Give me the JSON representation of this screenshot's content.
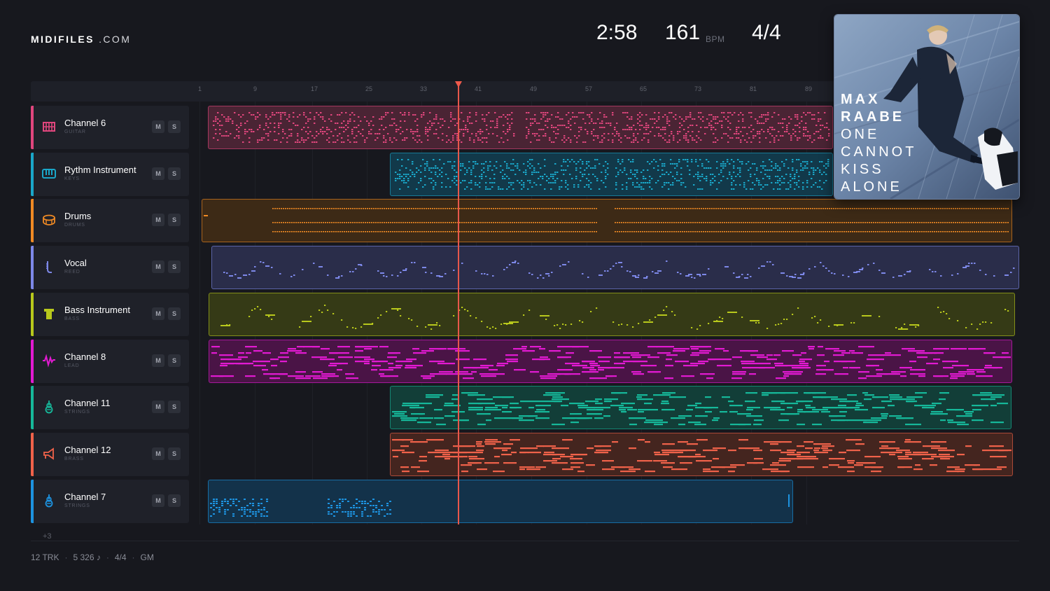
{
  "brand": {
    "name_bold": "MIDIFILES",
    "name_suffix": ".COM"
  },
  "transport": {
    "time": "2:58",
    "bpm": "161",
    "bpm_unit": "BPM",
    "time_signature": "4/4"
  },
  "album": {
    "lines": [
      "MAX",
      "RAABE",
      "ONE",
      "CANNOT",
      "KISS",
      "ALONE"
    ],
    "colors": {
      "bg": "#6f88ab",
      "dark": "#1c2638"
    }
  },
  "ruler": {
    "ticks": [
      "1",
      "9",
      "17",
      "25",
      "33",
      "41",
      "49",
      "57",
      "65",
      "73",
      "81",
      "89"
    ]
  },
  "playhead": {
    "color": "#ef5a4c"
  },
  "tracks": [
    {
      "name": "Channel 6",
      "type": "GUITAR",
      "icon": "guitar-icon",
      "color": "#e0467d",
      "clip_bg": "#4a2434",
      "mute": "M",
      "solo": "S"
    },
    {
      "name": "Rythm Instrument",
      "type": "KEYS",
      "icon": "keyboard-icon",
      "color": "#1aa7c9",
      "clip_bg": "#12394a",
      "mute": "M",
      "solo": "S"
    },
    {
      "name": "Drums",
      "type": "DRUMS",
      "icon": "drum-icon",
      "color": "#f08a24",
      "clip_bg": "#3d2a16",
      "mute": "M",
      "solo": "S"
    },
    {
      "name": "Vocal",
      "type": "REED",
      "icon": "reed-icon",
      "color": "#7d88e8",
      "clip_bg": "#2a2d4a",
      "mute": "M",
      "solo": "S"
    },
    {
      "name": "Bass Instrument",
      "type": "BASS",
      "icon": "bass-icon",
      "color": "#b8c81c",
      "clip_bg": "#353a16",
      "mute": "M",
      "solo": "S"
    },
    {
      "name": "Channel 8",
      "type": "LEAD",
      "icon": "lead-wave-icon",
      "color": "#e21ad2",
      "clip_bg": "#4a1446",
      "mute": "M",
      "solo": "S"
    },
    {
      "name": "Channel 11",
      "type": "STRINGS",
      "icon": "strings-icon",
      "color": "#16b89a",
      "clip_bg": "#123e38",
      "mute": "M",
      "solo": "S"
    },
    {
      "name": "Channel 12",
      "type": "BRASS",
      "icon": "brass-icon",
      "color": "#f0624a",
      "clip_bg": "#44251f",
      "mute": "M",
      "solo": "S"
    },
    {
      "name": "Channel 7",
      "type": "STRINGS",
      "icon": "strings-icon",
      "color": "#1d93e0",
      "clip_bg": "#13324a",
      "mute": "M",
      "solo": "S"
    }
  ],
  "more_tracks": "+3",
  "footer": {
    "tracks": "12 TRK",
    "notes": "5 326 ♪",
    "signature": "4/4",
    "standard": "GM"
  }
}
